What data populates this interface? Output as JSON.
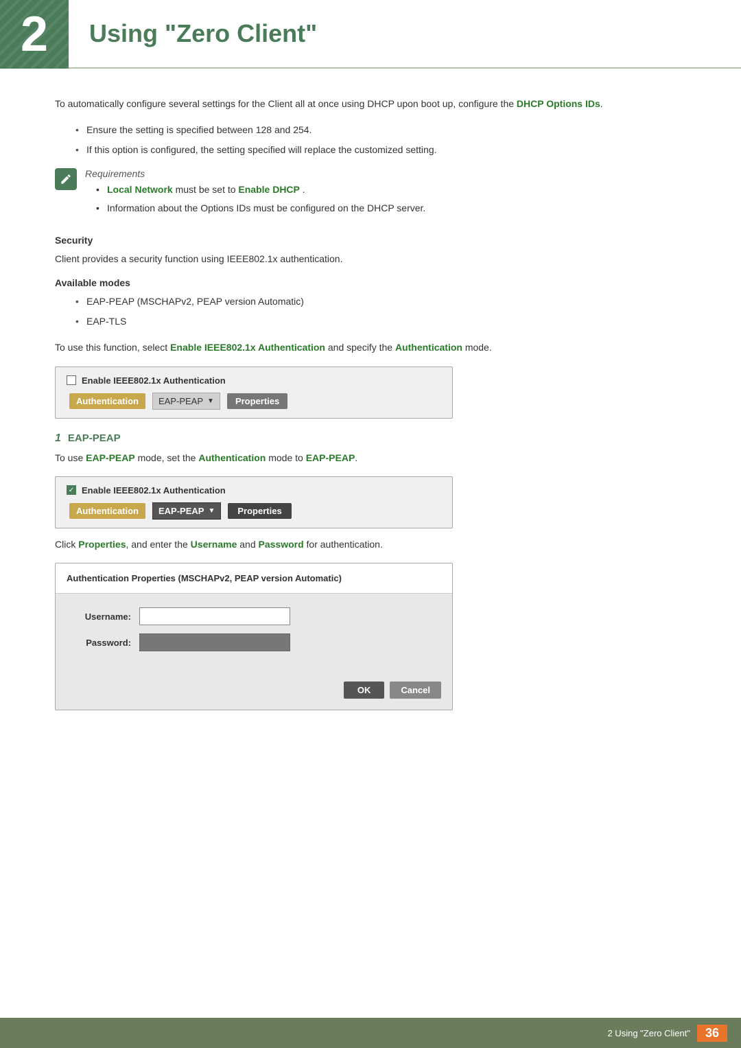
{
  "chapter": {
    "number": "2",
    "title": "Using \"Zero Client\""
  },
  "intro": {
    "text1": "To automatically configure several settings for the Client all at once using DHCP upon boot up, configure the ",
    "link": "DHCP Options IDs",
    "text2": "."
  },
  "bullets": [
    "Ensure the setting is specified between 128 and 254.",
    "If this option is configured, the setting specified will replace the customized setting."
  ],
  "note": {
    "label": "Requirements",
    "sub_bullets": [
      {
        "text_before": "",
        "link": "Local Network",
        "text_mid": " must be set to ",
        "link2": "Enable DHCP",
        "text_after": "."
      },
      {
        "text_plain": "Information about the Options IDs must be configured on the DHCP server."
      }
    ]
  },
  "security": {
    "heading": "Security",
    "text": "Client provides a security function using IEEE802.1x authentication."
  },
  "available_modes": {
    "heading": "Available modes",
    "bullets": [
      "EAP-PEAP (MSCHAPv2, PEAP version Automatic)",
      "EAP-TLS"
    ]
  },
  "instruction1": {
    "text_before": "To use this function, select ",
    "link1": "Enable IEEE802.1x Authentication",
    "text_mid": " and specify the ",
    "link2": "Authentication",
    "text_after": " mode."
  },
  "ui_box1": {
    "checkbox_checked": false,
    "header_text": "Enable IEEE802.1x Authentication",
    "label": "Authentication",
    "dropdown_text": "EAP-PEAP",
    "button_text": "Properties"
  },
  "eap_peap_section": {
    "number": "1",
    "title": "EAP-PEAP",
    "instruction": {
      "text_before": "To use ",
      "link1": "EAP-PEAP",
      "text_mid": " mode, set the ",
      "link2": "Authentication",
      "text_mid2": " mode to ",
      "link3": "EAP-PEAP",
      "text_after": "."
    }
  },
  "ui_box2": {
    "checkbox_checked": true,
    "header_text": "Enable IEEE802.1x Authentication",
    "label": "Authentication",
    "dropdown_text": "EAP-PEAP",
    "button_text": "Properties"
  },
  "instruction2": {
    "text_before": "Click ",
    "link1": "Properties",
    "text_mid": ", and enter the ",
    "link2": "Username",
    "text_mid2": " and ",
    "link3": "Password",
    "text_after": " for authentication."
  },
  "dialog": {
    "title": "Authentication Properties (MSCHAPv2, PEAP version Automatic)",
    "username_label": "Username:",
    "password_label": "Password:",
    "ok_button": "OK",
    "cancel_button": "Cancel"
  },
  "footer": {
    "text": "2 Using \"Zero Client\"",
    "page": "36"
  }
}
